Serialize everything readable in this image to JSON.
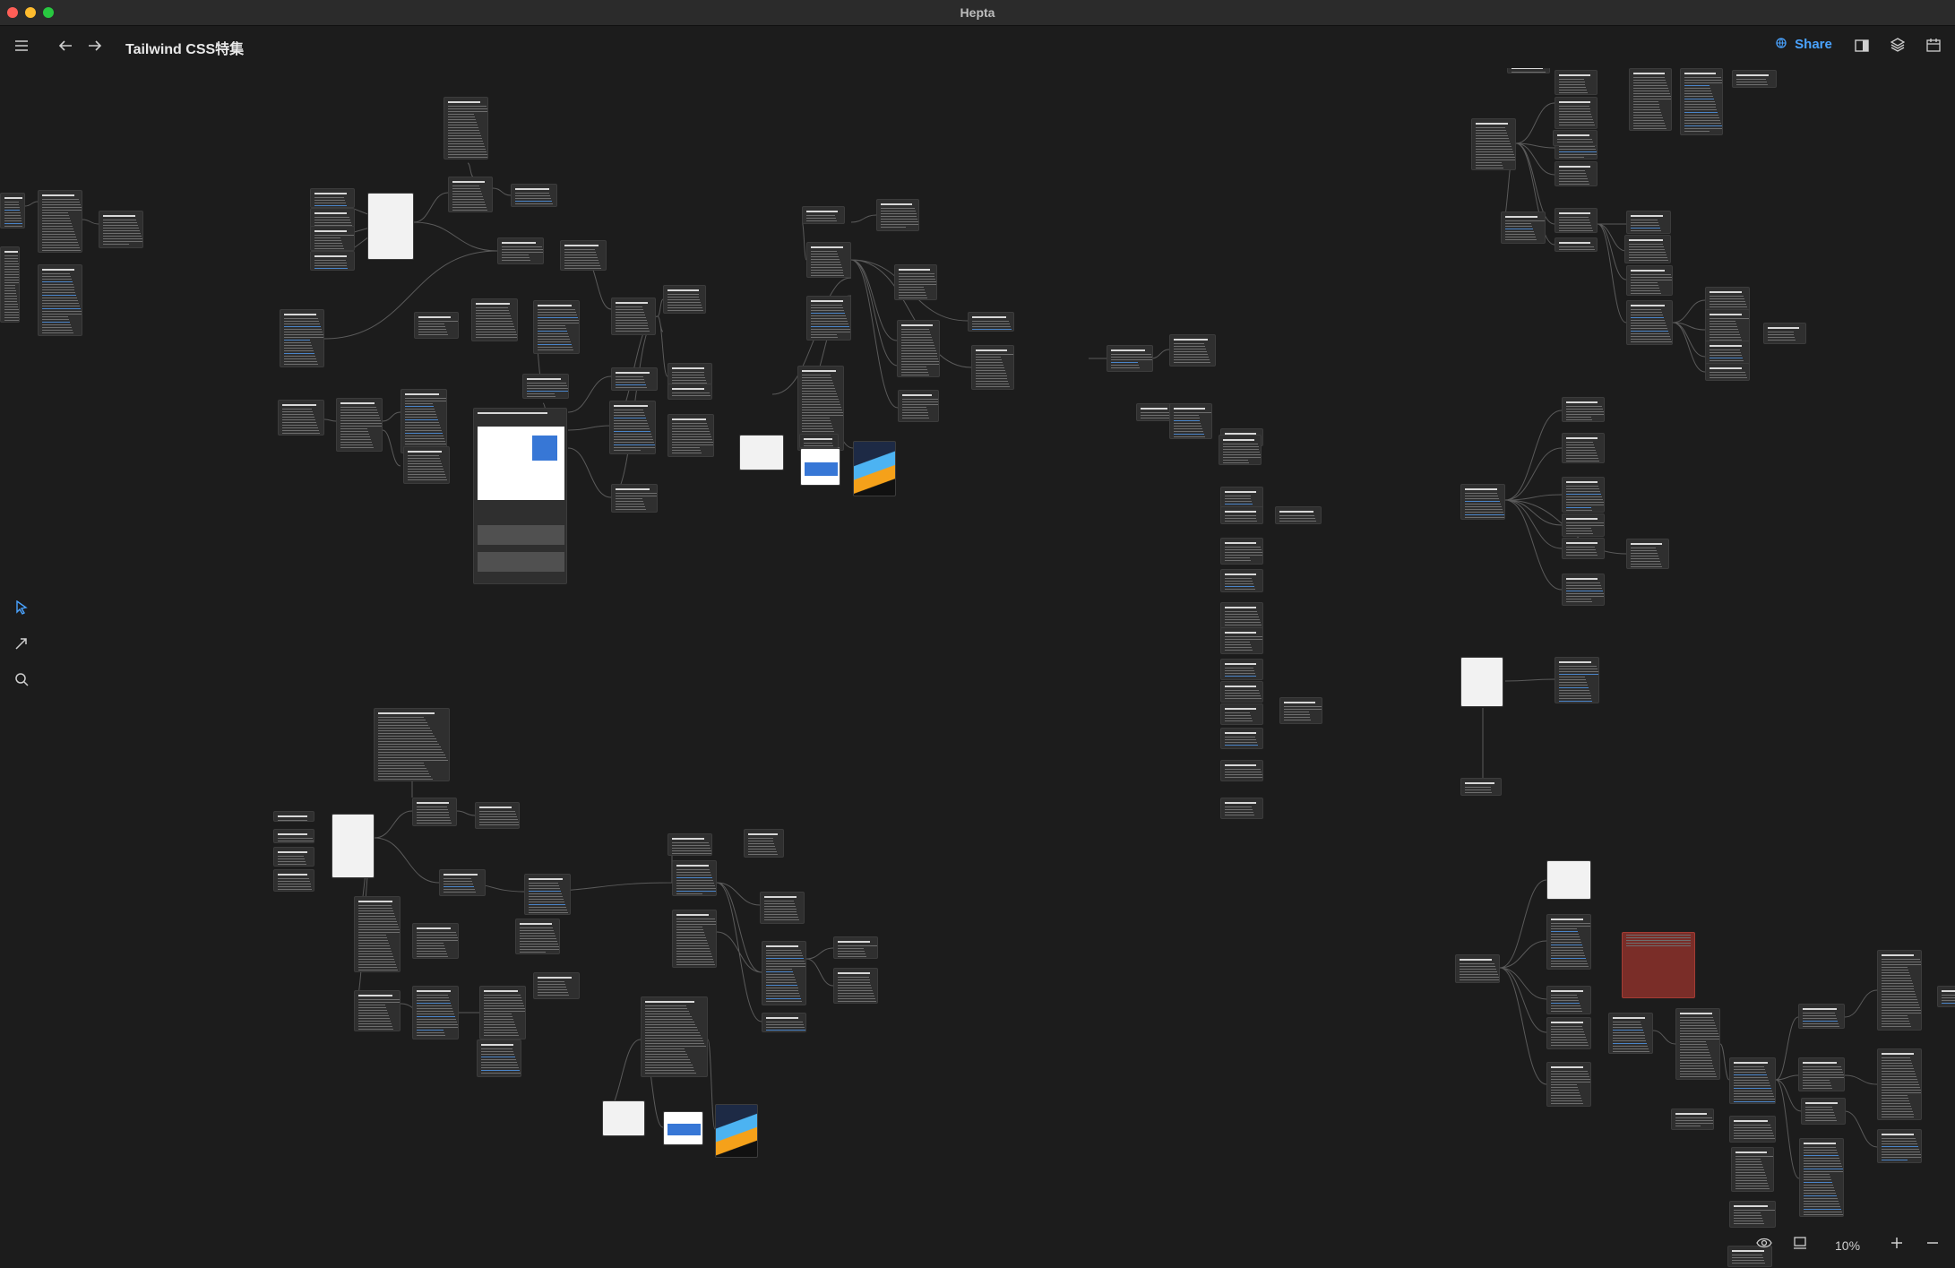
{
  "window": {
    "title": "Hepta",
    "controls": {
      "close_color": "#ff5f57",
      "minimize_color": "#febc2e",
      "zoom_color": "#28c840"
    }
  },
  "toolbar": {
    "menu_icon": "hamburger-menu-icon",
    "back_icon": "arrow-left-icon",
    "forward_icon": "arrow-right-icon",
    "document_title": "Tailwind CSS特集",
    "share_label": "Share",
    "share_icon": "globe-icon",
    "right_icons": [
      "sidebar-panel-icon",
      "layers-icon",
      "calendar-icon"
    ]
  },
  "left_tools": [
    {
      "name": "select-pointer-icon",
      "active": true
    },
    {
      "name": "connect-arrow-icon",
      "active": false
    },
    {
      "name": "search-icon",
      "active": false
    }
  ],
  "bottom_controls": {
    "view_icon": "eye-icon",
    "present_icon": "monitor-icon",
    "zoom_level": "10%",
    "zoom_in_icon": "plus-icon",
    "zoom_out_icon": "minus-icon"
  },
  "colors": {
    "canvas_bg": "#1c1c1c",
    "card_bg": "#2f2f2f",
    "edge": "#5a5a5a",
    "accent": "#4aa3ff",
    "highlight_card": "#7a2d28"
  }
}
